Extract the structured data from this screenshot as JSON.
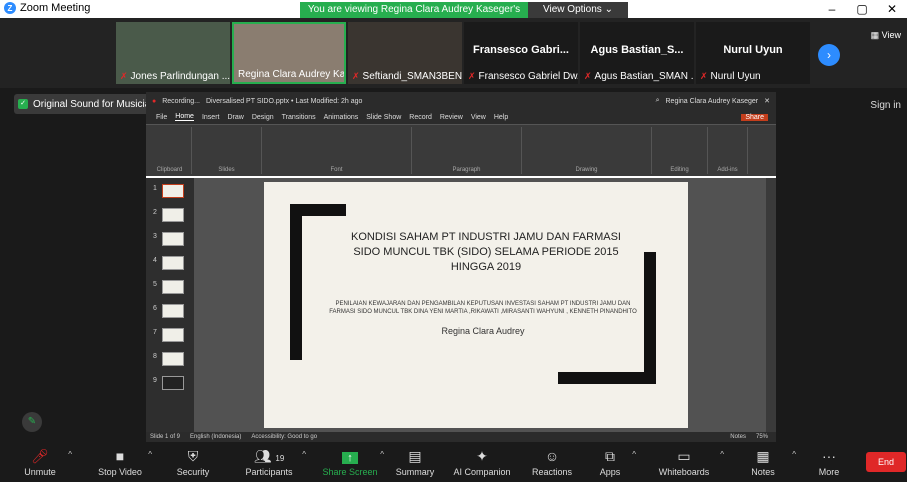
{
  "window": {
    "title": "Zoom Meeting",
    "banner": "You are viewing Regina Clara Audrey Kaseger's screen",
    "view_options": "View Options"
  },
  "strip": {
    "tiles": [
      {
        "name": "Jones Parlindungan ..."
      },
      {
        "name": "Regina Clara Audrey Kas..."
      },
      {
        "name": "Seftiandi_SMAN3BEN..."
      },
      {
        "name": "Fransesco Gabriel Dw...",
        "big": "Fransesco Gabri..."
      },
      {
        "name": "Agus Bastian_SMAN ...",
        "big": "Agus Bastian_S..."
      },
      {
        "name": "Nurul Uyun",
        "big": "Nurul Uyun"
      }
    ],
    "view_label": "View"
  },
  "sign_in": "Sign in",
  "original_sound": "Original Sound for Musicians: Off",
  "ppt": {
    "title": "Recording...",
    "doc": "Diversalised PT SIDO.pptx • Last Modified: 2h ago",
    "account": "Regina Clara Audrey Kaseger",
    "menu": [
      "File",
      "Home",
      "Insert",
      "Draw",
      "Design",
      "Transitions",
      "Animations",
      "Slide Show",
      "Record",
      "Review",
      "View",
      "Help"
    ],
    "share": "Share",
    "groups": [
      "Clipboard",
      "Slides",
      "Font",
      "Paragraph",
      "Drawing",
      "Editing",
      "Add-ins"
    ],
    "thumb_numbers": [
      "1",
      "2",
      "3",
      "4",
      "5",
      "6",
      "7",
      "8",
      "9"
    ],
    "slide": {
      "title": "KONDISI SAHAM PT INDUSTRI JAMU DAN FARMASI SIDO MUNCUL TBK (SIDO) SELAMA PERIODE 2015 HINGGA 2019",
      "subtitle": "PENILAIAN KEWAJARAN DAN PENGAMBILAN KEPUTUSAN INVESTASI SAHAM PT INDUSTRI JAMU DAN FARMASI SIDO MUNCUL TBK DINA YENI MARTIA ,RIKAWATI ,MIRASANTI WAHYUNI , KENNETH PINANDHITO",
      "author": "Regina Clara Audrey"
    },
    "status": {
      "slide": "Slide 1 of 9",
      "lang": "English (Indonesia)",
      "access": "Accessibility: Good to go",
      "notes": "Notes",
      "zoom": "75%"
    }
  },
  "toolbar": {
    "items": [
      {
        "label": "Unmute",
        "icon": "mic-off-icon"
      },
      {
        "label": "Stop Video",
        "icon": "video-icon"
      },
      {
        "label": "Security",
        "icon": "shield-icon"
      },
      {
        "label": "Participants",
        "icon": "participants-icon",
        "count": "19"
      },
      {
        "label": "Share Screen",
        "icon": "share-icon"
      },
      {
        "label": "Summary",
        "icon": "summary-icon"
      },
      {
        "label": "AI Companion",
        "icon": "ai-icon"
      },
      {
        "label": "Reactions",
        "icon": "reaction-icon"
      },
      {
        "label": "Apps",
        "icon": "apps-icon"
      },
      {
        "label": "Whiteboards",
        "icon": "whiteboard-icon"
      },
      {
        "label": "Notes",
        "icon": "notes-icon"
      },
      {
        "label": "More",
        "icon": "more-icon"
      }
    ],
    "end": "End"
  },
  "colors": {
    "accent": "#2d8cff",
    "green": "#27ae4f",
    "red": "#e02828"
  }
}
